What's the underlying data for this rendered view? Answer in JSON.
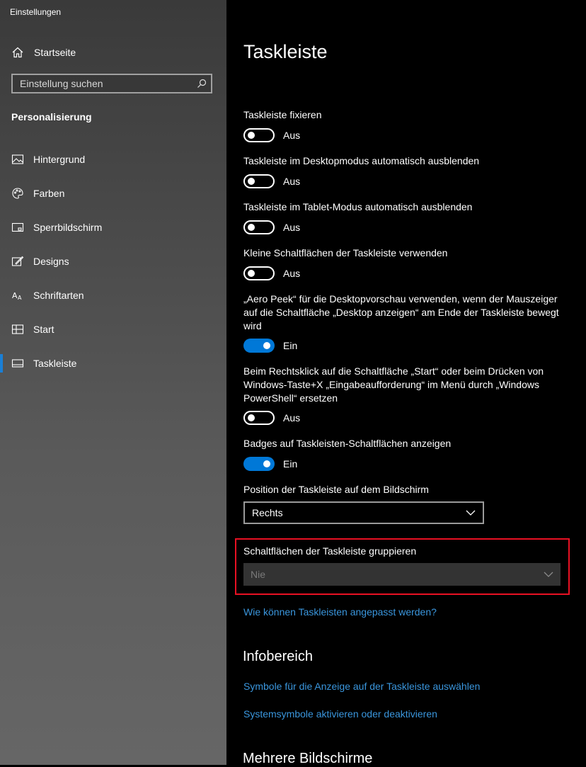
{
  "window": {
    "title": "Einstellungen"
  },
  "sidebar": {
    "home_label": "Startseite",
    "search_placeholder": "Einstellung suchen",
    "section_title": "Personalisierung",
    "items": [
      {
        "label": "Hintergrund",
        "icon": "picture-icon"
      },
      {
        "label": "Farben",
        "icon": "palette-icon"
      },
      {
        "label": "Sperrbildschirm",
        "icon": "lockscreen-icon"
      },
      {
        "label": "Designs",
        "icon": "designs-icon"
      },
      {
        "label": "Schriftarten",
        "icon": "fonts-icon"
      },
      {
        "label": "Start",
        "icon": "start-icon"
      },
      {
        "label": "Taskleiste",
        "icon": "taskbar-icon",
        "active": true
      }
    ],
    "accent_color": "#1a7fd6"
  },
  "main": {
    "title": "Taskleiste",
    "settings": [
      {
        "label": "Taskleiste fixieren",
        "state": "Aus",
        "on": false
      },
      {
        "label": "Taskleiste im Desktopmodus automatisch ausblenden",
        "state": "Aus",
        "on": false
      },
      {
        "label": "Taskleiste im Tablet-Modus automatisch ausblenden",
        "state": "Aus",
        "on": false
      },
      {
        "label": "Kleine Schaltflächen der Taskleiste verwenden",
        "state": "Aus",
        "on": false
      },
      {
        "label": "„Aero Peek“ für die Desktopvorschau verwenden, wenn der Mauszeiger auf die Schaltfläche „Desktop anzeigen“ am Ende der Taskleiste bewegt wird",
        "state": "Ein",
        "on": true
      },
      {
        "label": "Beim Rechtsklick auf die Schaltfläche „Start“ oder beim Drücken von Windows-Taste+X „Eingabeaufforderung“ im Menü durch „Windows PowerShell“ ersetzen",
        "state": "Aus",
        "on": false
      },
      {
        "label": "Badges auf Taskleisten-Schaltflächen anzeigen",
        "state": "Ein",
        "on": true
      }
    ],
    "position": {
      "label": "Position der Taskleiste auf dem Bildschirm",
      "value": "Rechts"
    },
    "grouping": {
      "label": "Schaltflächen der Taskleiste gruppieren",
      "value": "Nie",
      "disabled": true
    },
    "help_link": "Wie können Taskleisten angepasst werden?",
    "infobereich": {
      "heading": "Infobereich",
      "links": [
        "Symbole für die Anzeige auf der Taskleiste auswählen",
        "Systemsymbole aktivieren oder deaktivieren"
      ]
    },
    "next_heading": "Mehrere Bildschirme",
    "toggle_on_color": "#0078d7",
    "link_color": "#3a96dd",
    "highlight_color": "#e81123"
  }
}
